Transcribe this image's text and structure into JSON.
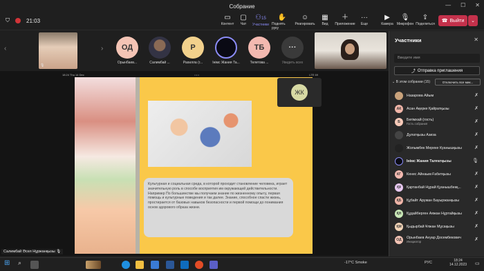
{
  "window": {
    "title": "Собрание",
    "timer": "21:03"
  },
  "toolbar": {
    "items": [
      {
        "label": "Контент",
        "icon": "share-screen-icon"
      },
      {
        "label": "Чат",
        "icon": "chat-icon"
      },
      {
        "label": "Участники",
        "icon": "people-icon",
        "badge": "15",
        "active": true
      },
      {
        "label": "Поднять руку",
        "icon": "raise-hand-icon"
      },
      {
        "label": "Реагировать",
        "icon": "smile-icon"
      },
      {
        "label": "Вид",
        "icon": "view-icon"
      },
      {
        "label": "Приложение",
        "icon": "apps-icon"
      },
      {
        "label": "Еще",
        "icon": "more-icon"
      }
    ],
    "camera": "Камера",
    "mic": "Микрофон",
    "share": "Поделиться",
    "leave": "Выйти"
  },
  "gallery": {
    "participants": [
      {
        "initials": "ОД",
        "name": "Орынбаев...",
        "color": "#f4c4b5"
      },
      {
        "initials": "",
        "name": "Салимбай ...",
        "color": "#333"
      },
      {
        "initials": "Р",
        "name": "Рахилла (г...",
        "color": "#f2d18c"
      },
      {
        "initials": "",
        "name": "Iнiмс Жания Та...",
        "color": "#111"
      },
      {
        "initials": "ТБ",
        "name": "Телетова ...",
        "color": "#f3b9b0"
      },
      {
        "initials": "···",
        "name": "Увидеть всех",
        "color": "#3a3a3a"
      }
    ]
  },
  "share": {
    "status_left": "18:24  Thu 14 Dec",
    "status_right": "LTE 69",
    "slide_text": "Культурная и социальная среда, в которой проходит становление человека, играет значительную роль в способе восприятия им окружающей действительности. Например По большинстве мы получаем знание по жизненному опыту, первая помощь и культурные поведения и так далее. Знание, способное спасти жизнь, простирается от базовых навыков безопасности и первой помощи до понимания основ здорового образа жизни.",
    "presenter": "Салимбай Әсел Нұржанқызы",
    "overlay_initials": "ЖК"
  },
  "panel": {
    "title": "Участники",
    "search_placeholder": "Введите имя",
    "invite": "Отправка приглашения",
    "section": "В этом собрании (15)",
    "mute_all": "Отключить все мик...",
    "people": [
      {
        "initials": "",
        "name": "Назарова Айым",
        "sub": "",
        "color": "#c9a27b",
        "mic": "muted"
      },
      {
        "initials": "АК",
        "name": "Асан Ақерке Қайратқызы",
        "sub": "",
        "color": "#f0b5a8",
        "mic": "muted"
      },
      {
        "initials": "Б",
        "name": "Бегімхай (гость)",
        "sub": "Гость собрания",
        "color": "#f6c9b8",
        "mic": "muted"
      },
      {
        "initials": "",
        "name": "Дулатқызы Азиза",
        "sub": "",
        "color": "#444",
        "mic": "muted"
      },
      {
        "initials": "",
        "name": "Жолымбек Мереке Куанышқызы",
        "sub": "",
        "color": "#222",
        "mic": "muted"
      },
      {
        "initials": "",
        "name": "Iнiмс Жания Талғатқызы",
        "sub": "",
        "color": "#111",
        "mic": "on"
      },
      {
        "initials": "КГ",
        "name": "Кенес Айнаым Ғабитқызы",
        "sub": "",
        "color": "#f3b9b0",
        "mic": "muted"
      },
      {
        "initials": "ҚҰ",
        "name": "Қартанбай Нұрай Қуанышбекқ...",
        "sub": "",
        "color": "#e9c9f2",
        "mic": "muted"
      },
      {
        "initials": "ҚБ",
        "name": "Құбайт Аружан Бауыржанқызы",
        "sub": "",
        "color": "#f0b5a8",
        "mic": "muted"
      },
      {
        "initials": "ҚН",
        "name": "Құдайберген Аяжан Нұртайқызы",
        "sub": "",
        "color": "#c9e8b7",
        "mic": "muted"
      },
      {
        "initials": "ҚМ",
        "name": "Қыдырбай Ұлжан Мұсақызы",
        "sub": "",
        "color": "#f3d5b8",
        "mic": "muted"
      },
      {
        "initials": "ОД",
        "name": "Орынбаев Ануар Досембекович",
        "sub": "Инициатор",
        "color": "#f4c4b5",
        "mic": "muted"
      }
    ]
  },
  "taskbar": {
    "weather": "-17°C Smoke",
    "lang": "РУС",
    "time": "18:24",
    "date": "14.12.2023"
  }
}
